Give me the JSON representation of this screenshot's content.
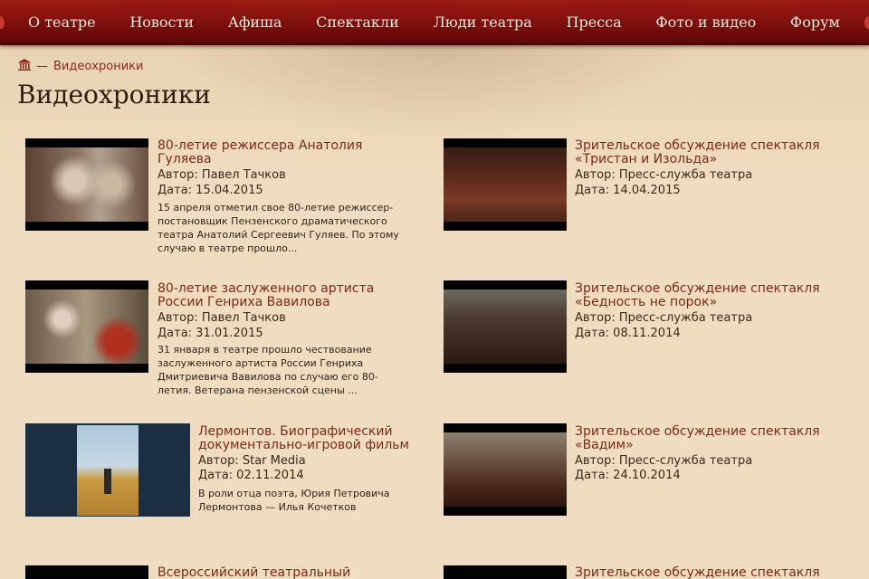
{
  "nav": [
    {
      "label": "О театре"
    },
    {
      "label": "Новости"
    },
    {
      "label": "Афиша"
    },
    {
      "label": "Спектакли"
    },
    {
      "label": "Люди театра"
    },
    {
      "label": "Пресса"
    },
    {
      "label": "Фото и видео"
    },
    {
      "label": "Форум"
    }
  ],
  "breadcrumb": {
    "home_icon": "theater-building-icon",
    "separator": "—",
    "current": "Видеохроники"
  },
  "page_title": "Видеохроники",
  "videos": [
    {
      "title": "80-летие режиссера Анатолия Гуляева",
      "author": "Автор: Павел Тачков",
      "date": "Дата: 15.04.2015",
      "desc": "15 апреля отметил свое 80-летие режиссер-постановщик Пензенского драматического театра Анатолий Сергеевич Гуляев. По этому случаю в театре прошло..."
    },
    {
      "title": "Зрительское обсуждение спектакля «Тристан и Изольда»",
      "author": "Автор: Пресс-служба театра",
      "date": "Дата: 14.04.2015"
    },
    {
      "title": "80-летие заслуженного артиста России Генриха Вавилова",
      "author": "Автор: Павел Тачков",
      "date": "Дата: 31.01.2015",
      "desc": "31 января в театре прошло чествование заслуженного артиста России Генриха Дмитриевича Вавилова по случаю его 80-летия. Ветерана пензенской сцены ..."
    },
    {
      "title": "Зрительское обсуждение спектакля «Бедность не порок»",
      "author": "Автор: Пресс-служба театра",
      "date": "Дата: 08.11.2014"
    },
    {
      "title": "Лермонтов. Биографический документально-игровой фильм",
      "author": "Автор: Star Media",
      "date": "Дата: 02.11.2014",
      "desc": "В роли отца поэта, Юрия Петровича Лермонтова — Илья Кочетков"
    },
    {
      "title": "Зрительское обсуждение спектакля «Вадим»",
      "author": "Автор: Пресс-служба театра",
      "date": "Дата: 24.10.2014"
    },
    {
      "title": "Всероссийский театральный"
    },
    {
      "title": "Зрительское обсуждение спектакля"
    }
  ]
}
